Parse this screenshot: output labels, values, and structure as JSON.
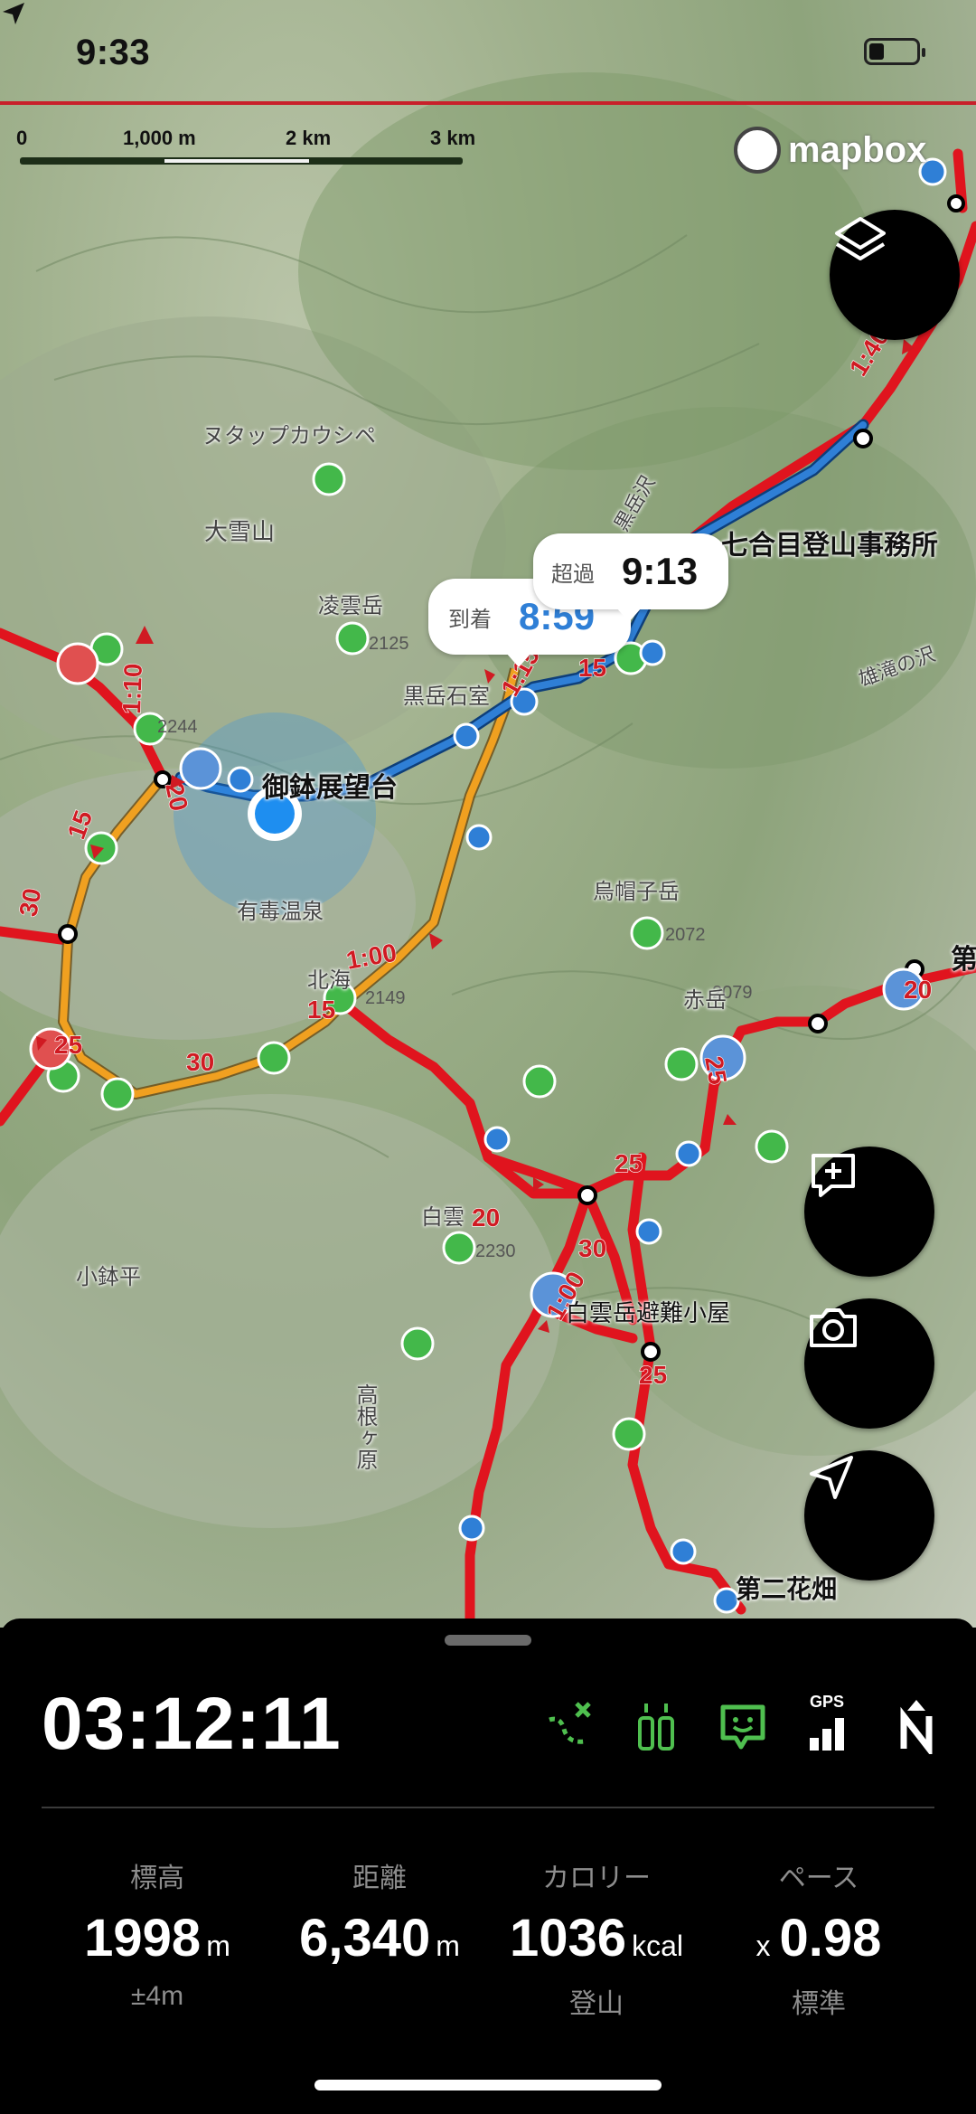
{
  "status_bar": {
    "time": "9:33"
  },
  "scale": {
    "labels": [
      "0",
      "1,000 m",
      "2 km",
      "3 km"
    ]
  },
  "map": {
    "attribution": "mapbox",
    "callouts": {
      "arrival": {
        "label": "到着",
        "time": "8:59"
      },
      "overtime": {
        "label": "超過",
        "time": "9:13"
      }
    },
    "places": [
      "御鉢展望台",
      "七合目登山事務所",
      "第二花畑",
      "白雲岳避難小屋",
      "ヌタップカウシペ",
      "大雪山",
      "凌雲岳",
      "黒岳石室",
      "黒岳沢",
      "雄滝の沢",
      "烏帽子岳",
      "赤岳",
      "北海",
      "有毒温泉",
      "小鉢平",
      "高根ヶ原",
      "白雲",
      "第"
    ],
    "elevations": [
      "2125",
      "2244",
      "2072",
      "2079",
      "2230",
      "2149"
    ],
    "trail_times": [
      "1:40",
      "1:10",
      "15",
      "20",
      "30",
      "25",
      "1:00",
      "15",
      "30",
      "20",
      "25",
      "20",
      "30",
      "1:00",
      "25",
      "15",
      "1:15",
      "25"
    ]
  },
  "buttons": {
    "layers": "layers-icon",
    "add_note": "add-note-icon",
    "camera": "camera-icon",
    "locate": "navigation-icon"
  },
  "panel": {
    "elapsed": "03:12:11",
    "gps_label": "GPS",
    "stats": [
      {
        "label": "標高",
        "value": "1998",
        "unit": "m",
        "prefix": "",
        "sub": "±4m"
      },
      {
        "label": "距離",
        "value": "6,340",
        "unit": "m",
        "prefix": "",
        "sub": ""
      },
      {
        "label": "カロリー",
        "value": "1036",
        "unit": "kcal",
        "prefix": "",
        "sub": "登山"
      },
      {
        "label": "ペース",
        "value": "0.98",
        "unit": "",
        "prefix": "x",
        "sub": "標準"
      }
    ]
  },
  "colors": {
    "route": "#e0141e",
    "track": "#2f7fd6",
    "planned": "#f0a020",
    "accent_green": "#4fbf4f",
    "location": "#1e8ef0"
  }
}
